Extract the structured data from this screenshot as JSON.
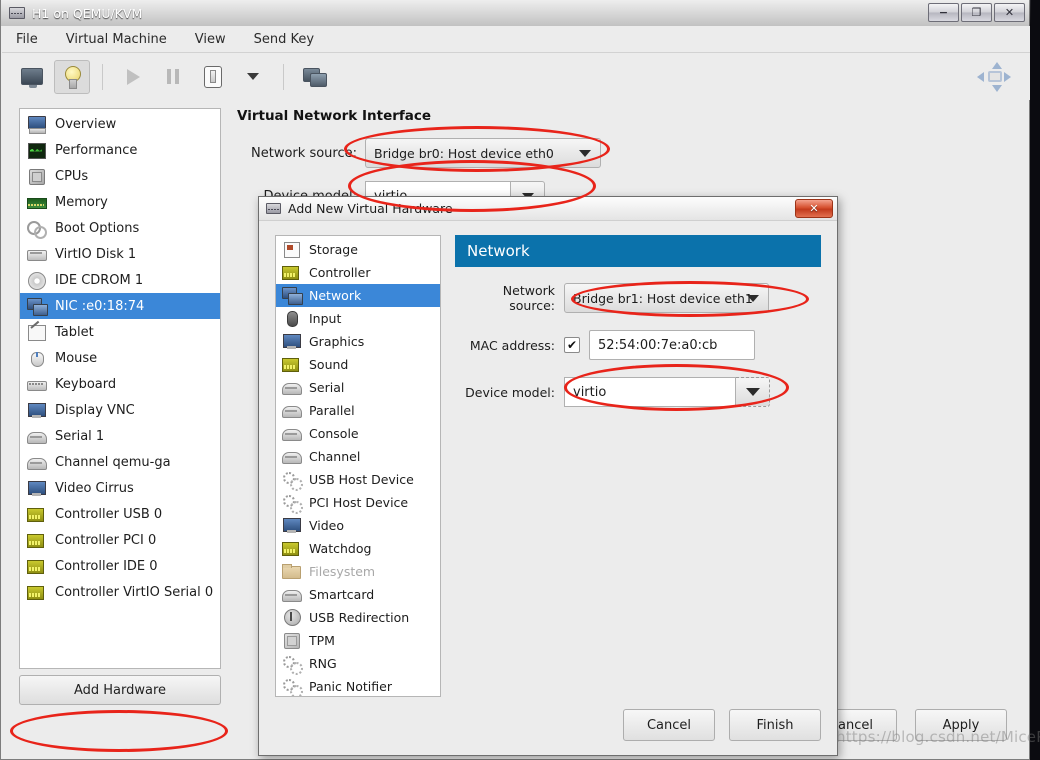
{
  "window": {
    "title": "H1 on QEMU/KVM",
    "icon": "vm-icon",
    "controls": {
      "minimize": "−",
      "maximize": "❐",
      "close": "✕"
    }
  },
  "menubar": {
    "items": [
      {
        "label": "File"
      },
      {
        "label": "Virtual Machine"
      },
      {
        "label": "View"
      },
      {
        "label": "Send Key"
      }
    ]
  },
  "toolbar": {
    "buttons": [
      {
        "name": "console-view-button",
        "icon": "monitor-icon"
      },
      {
        "name": "details-view-button",
        "icon": "lightbulb-icon",
        "active": true
      },
      {
        "name": "run-button",
        "icon": "play-icon"
      },
      {
        "name": "pause-button",
        "icon": "pause-icon"
      },
      {
        "name": "shutdown-button",
        "icon": "power-icon"
      },
      {
        "name": "shutdown-menu-button",
        "icon": "chevron-down-icon"
      },
      {
        "name": "snapshots-button",
        "icon": "snapshots-icon"
      }
    ],
    "fullscreen_icon": "fullscreen-icon"
  },
  "sidebar": {
    "items": [
      {
        "label": "Overview",
        "icon": "computer-icon"
      },
      {
        "label": "Performance",
        "icon": "performance-graph-icon"
      },
      {
        "label": "CPUs",
        "icon": "cpu-chip-icon"
      },
      {
        "label": "Memory",
        "icon": "memory-stick-icon"
      },
      {
        "label": "Boot Options",
        "icon": "gears-icon"
      },
      {
        "label": "VirtIO Disk 1",
        "icon": "harddisk-icon"
      },
      {
        "label": "IDE CDROM 1",
        "icon": "cdrom-icon"
      },
      {
        "label": "NIC :e0:18:74",
        "icon": "network-card-icon",
        "selected": true
      },
      {
        "label": "Tablet",
        "icon": "tablet-icon"
      },
      {
        "label": "Mouse",
        "icon": "mouse-icon"
      },
      {
        "label": "Keyboard",
        "icon": "keyboard-icon"
      },
      {
        "label": "Display VNC",
        "icon": "display-icon"
      },
      {
        "label": "Serial 1",
        "icon": "serial-port-icon"
      },
      {
        "label": "Channel qemu-ga",
        "icon": "serial-port-icon"
      },
      {
        "label": "Video Cirrus",
        "icon": "display-icon"
      },
      {
        "label": "Controller USB 0",
        "icon": "controller-card-icon"
      },
      {
        "label": "Controller PCI 0",
        "icon": "controller-card-icon"
      },
      {
        "label": "Controller IDE 0",
        "icon": "controller-card-icon"
      },
      {
        "label": "Controller VirtIO Serial 0",
        "icon": "controller-card-icon"
      }
    ],
    "add_hardware_label": "Add Hardware"
  },
  "main_panel": {
    "title": "Virtual Network Interface",
    "network_source_label": "Network source:",
    "network_source_value": "Bridge br0: Host device eth0",
    "device_model_label": "Device model:",
    "device_model_value": "virtio",
    "buttons": {
      "cancel": "Cancel",
      "apply": "Apply"
    }
  },
  "dialog": {
    "title": "Add New Virtual Hardware",
    "icon": "vm-icon",
    "close_label": "✕",
    "hardware_types": [
      {
        "label": "Storage",
        "icon": "storage-icon"
      },
      {
        "label": "Controller",
        "icon": "controller-card-icon"
      },
      {
        "label": "Network",
        "icon": "network-card-icon",
        "selected": true
      },
      {
        "label": "Input",
        "icon": "input-device-icon"
      },
      {
        "label": "Graphics",
        "icon": "display-icon"
      },
      {
        "label": "Sound",
        "icon": "controller-card-icon"
      },
      {
        "label": "Serial",
        "icon": "serial-port-icon"
      },
      {
        "label": "Parallel",
        "icon": "serial-port-icon"
      },
      {
        "label": "Console",
        "icon": "serial-port-icon"
      },
      {
        "label": "Channel",
        "icon": "serial-port-icon"
      },
      {
        "label": "USB Host Device",
        "icon": "gears-icon"
      },
      {
        "label": "PCI Host Device",
        "icon": "gears-icon"
      },
      {
        "label": "Video",
        "icon": "display-icon"
      },
      {
        "label": "Watchdog",
        "icon": "controller-card-icon"
      },
      {
        "label": "Filesystem",
        "icon": "folder-icon",
        "disabled": true
      },
      {
        "label": "Smartcard",
        "icon": "serial-port-icon"
      },
      {
        "label": "USB Redirection",
        "icon": "usb-icon"
      },
      {
        "label": "TPM",
        "icon": "chip-icon"
      },
      {
        "label": "RNG",
        "icon": "gears-icon"
      },
      {
        "label": "Panic Notifier",
        "icon": "gears-icon"
      }
    ],
    "section_title": "Network",
    "network_source_label": "Network source:",
    "network_source_value": "Bridge br1: Host device eth1",
    "mac_address_label": "MAC address:",
    "mac_address_checked": true,
    "mac_address_value": "52:54:00:7e:a0:cb",
    "device_model_label": "Device model:",
    "device_model_value": "virtio",
    "buttons": {
      "cancel": "Cancel",
      "finish": "Finish"
    }
  },
  "annotations": {
    "watermark": "https://blog.csdn.net/MicePro",
    "highlight_color": "#e8241a",
    "ellipses": [
      "network-source-main-ellipse",
      "device-model-main-ellipse",
      "dialog-network-source-ellipse",
      "dialog-device-model-ellipse",
      "add-hardware-ellipse"
    ]
  },
  "colors": {
    "selection_blue": "#3b87d8",
    "section_header_blue": "#0b72ab",
    "window_chrome": "#ececec",
    "close_red": "#d6502f"
  }
}
